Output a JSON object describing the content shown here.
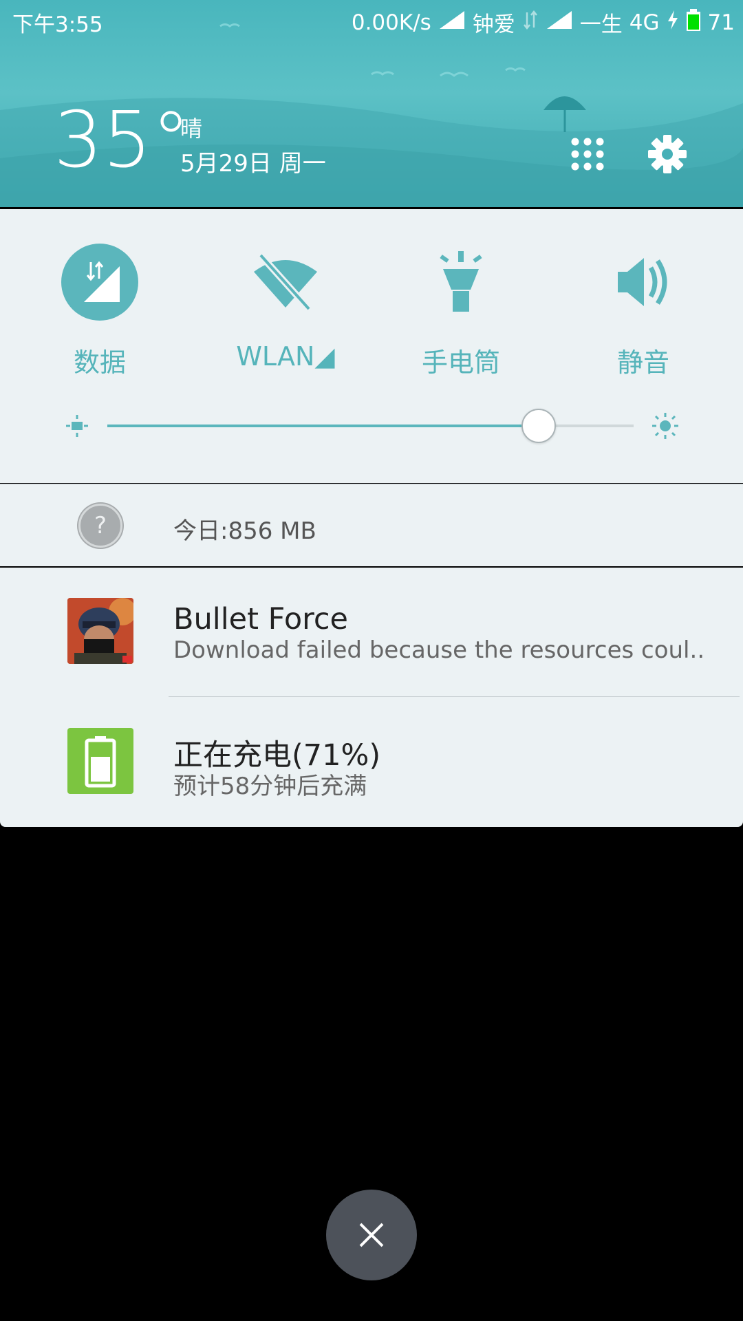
{
  "status_bar": {
    "time": "下午3:55",
    "net_speed": "0.00K/s",
    "carrier1": "钟爱",
    "carrier2": "一生",
    "network_type": "4G",
    "battery": "71"
  },
  "weather": {
    "temperature": "35°",
    "condition": "晴",
    "date": "5月29日 周一"
  },
  "quick_settings": {
    "tiles": [
      {
        "label": "数据",
        "icon": "mobile-data-icon",
        "active": true
      },
      {
        "label": "WLAN◢",
        "icon": "wifi-off-icon",
        "active": false
      },
      {
        "label": "手电筒",
        "icon": "flashlight-icon",
        "active": false
      },
      {
        "label": "静音",
        "icon": "volume-icon",
        "active": false
      }
    ],
    "brightness": 0.82
  },
  "data_usage": {
    "text": "今日:856 MB"
  },
  "notifications": [
    {
      "title": "Bullet Force",
      "subtitle": "Download failed because the resources coul..",
      "icon": "bullet-force-app-icon"
    },
    {
      "title": "正在充电(71%)",
      "subtitle": "预计58分钟后充满",
      "icon": "battery-charging-icon"
    }
  ],
  "colors": {
    "accent": "#55b4ba",
    "header": "#4cb5bc",
    "panel": "#ecf2f4",
    "battery_green": "#00e000",
    "charging_green": "#7cc540"
  }
}
